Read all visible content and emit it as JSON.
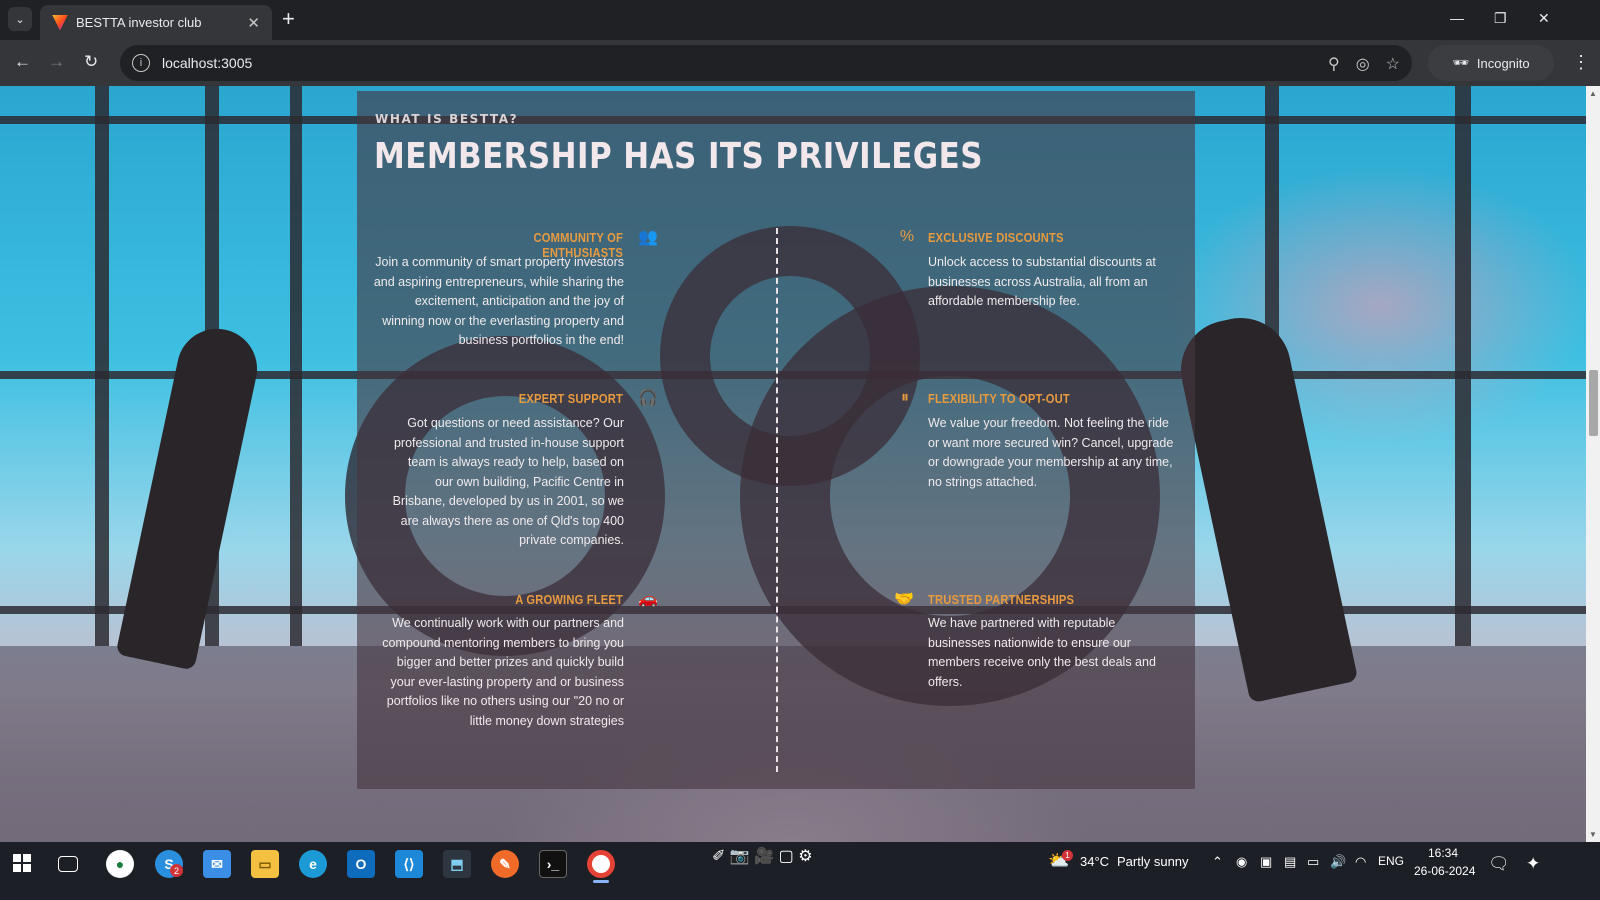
{
  "browser": {
    "tab_title": "BESTTA investor club",
    "url": "localhost:3005",
    "incognito_label": "Incognito"
  },
  "page": {
    "eyebrow": "WHAT IS BESTTA?",
    "headline": "MEMBERSHIP HAS ITS PRIVILEGES",
    "features_left": [
      {
        "title": "COMMUNITY OF ENTHUSIASTS",
        "icon": "users-icon",
        "text": "Join a community of smart property investors and aspiring entrepreneurs, while sharing the excitement, anticipation and the joy of winning now or the everlasting property and business portfolios in the end!"
      },
      {
        "title": "EXPERT SUPPORT",
        "icon": "headset-icon",
        "text": "Got questions or need assistance? Our professional and trusted in-house support team is always ready to help, based on our own building, Pacific Centre in Brisbane, developed by us in 2001, so we are always there as one of Qld's top 400 private companies."
      },
      {
        "title": "A GROWING FLEET",
        "icon": "car-icon",
        "text": "We continually work with our partners and compound mentoring members to bring you bigger and better prizes and quickly build your ever-lasting property and or business portfolios like no others using our \"20 no or little money down strategies"
      }
    ],
    "features_right": [
      {
        "title": "EXCLUSIVE DISCOUNTS",
        "icon": "percent-icon",
        "text": "Unlock access to substantial discounts at businesses across Australia, all from an affordable membership fee."
      },
      {
        "title": "FLEXIBILITY TO OPT-OUT",
        "icon": "pause-icon",
        "text": "We value your freedom. Not feeling the ride or want more secured win? Cancel, upgrade or downgrade your membership at any time, no strings attached."
      },
      {
        "title": "TRUSTED PARTNERSHIPS",
        "icon": "handshake-icon",
        "text": "We have partnered with reputable businesses nationwide to ensure our members receive only the best deals and offers."
      }
    ]
  },
  "taskbar": {
    "weather_temp": "34°C",
    "weather_text": "Partly sunny",
    "language": "ENG",
    "time": "16:34",
    "date": "26-06-2024",
    "skype_badge": "2",
    "weather_badge": "1"
  },
  "colors": {
    "accent": "#e89a3f",
    "panel": "#46373f"
  }
}
